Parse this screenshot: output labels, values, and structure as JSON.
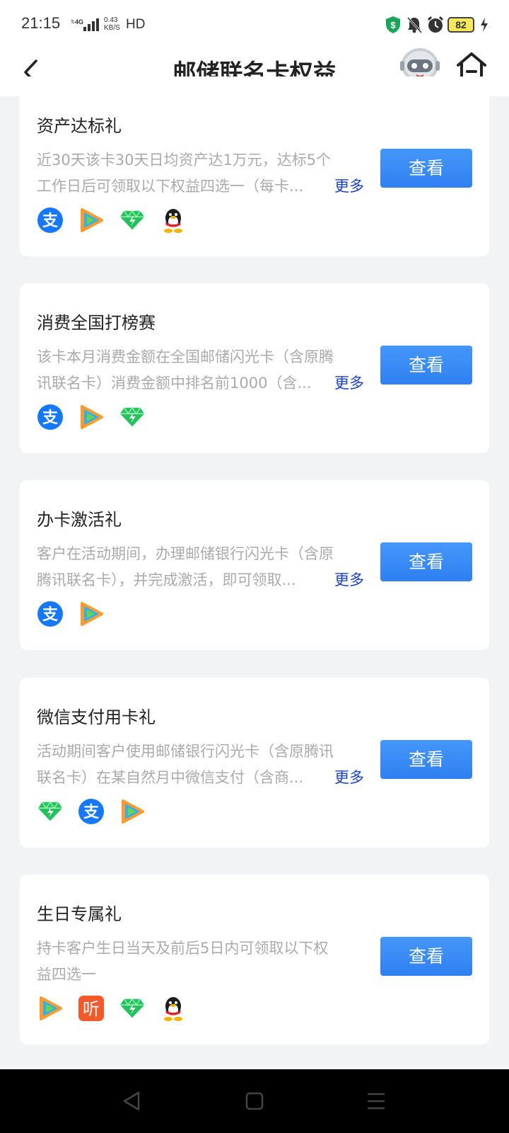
{
  "status": {
    "time": "21:15",
    "net": "4G",
    "speed_value": "0.43",
    "speed_unit": "KB/S",
    "hd": "HD",
    "battery": "82"
  },
  "nav": {
    "title": "邮储联名卡权益"
  },
  "more_label": "更多",
  "button_label": "查看",
  "cards": [
    {
      "title": "资产达标礼",
      "desc_line1": "近30天该卡30天日均资产达1万元，达标5个",
      "desc_line2": "工作日后可领取以下权益四选一（每卡...",
      "has_more": true,
      "icons": [
        "alipay-icon",
        "tencent-video-icon",
        "diamond-icon",
        "qq-penguin-icon"
      ]
    },
    {
      "title": "消费全国打榜赛",
      "desc_line1": "该卡本月消费金额在全国邮储闪光卡（含原腾",
      "desc_line2": "讯联名卡）消费金额中排名前1000（含...",
      "has_more": true,
      "icons": [
        "alipay-icon",
        "tencent-video-icon",
        "diamond-icon"
      ]
    },
    {
      "title": "办卡激活礼",
      "desc_line1": "客户在活动期间，办理邮储银行闪光卡（含原",
      "desc_line2": "腾讯联名卡），并完成激活，即可领取...",
      "has_more": true,
      "icons": [
        "alipay-icon",
        "tencent-video-icon"
      ]
    },
    {
      "title": "微信支付用卡礼",
      "desc_line1": "活动期间客户使用邮储银行闪光卡（含原腾讯",
      "desc_line2": "联名卡）在某自然月中微信支付（含商...",
      "has_more": true,
      "icons": [
        "diamond-icon",
        "alipay-icon",
        "tencent-video-icon"
      ]
    },
    {
      "title": "生日专属礼",
      "desc_line1": "持卡客户生日当天及前后5日内可领取以下权",
      "desc_line2": "益四选一",
      "has_more": false,
      "icons": [
        "tencent-video-icon",
        "ting-audio-icon",
        "diamond-icon",
        "qq-penguin-icon"
      ]
    }
  ],
  "colors": {
    "accent": "#3d8ef7",
    "more": "#1a3fcf",
    "background": "#f2f3f5"
  }
}
